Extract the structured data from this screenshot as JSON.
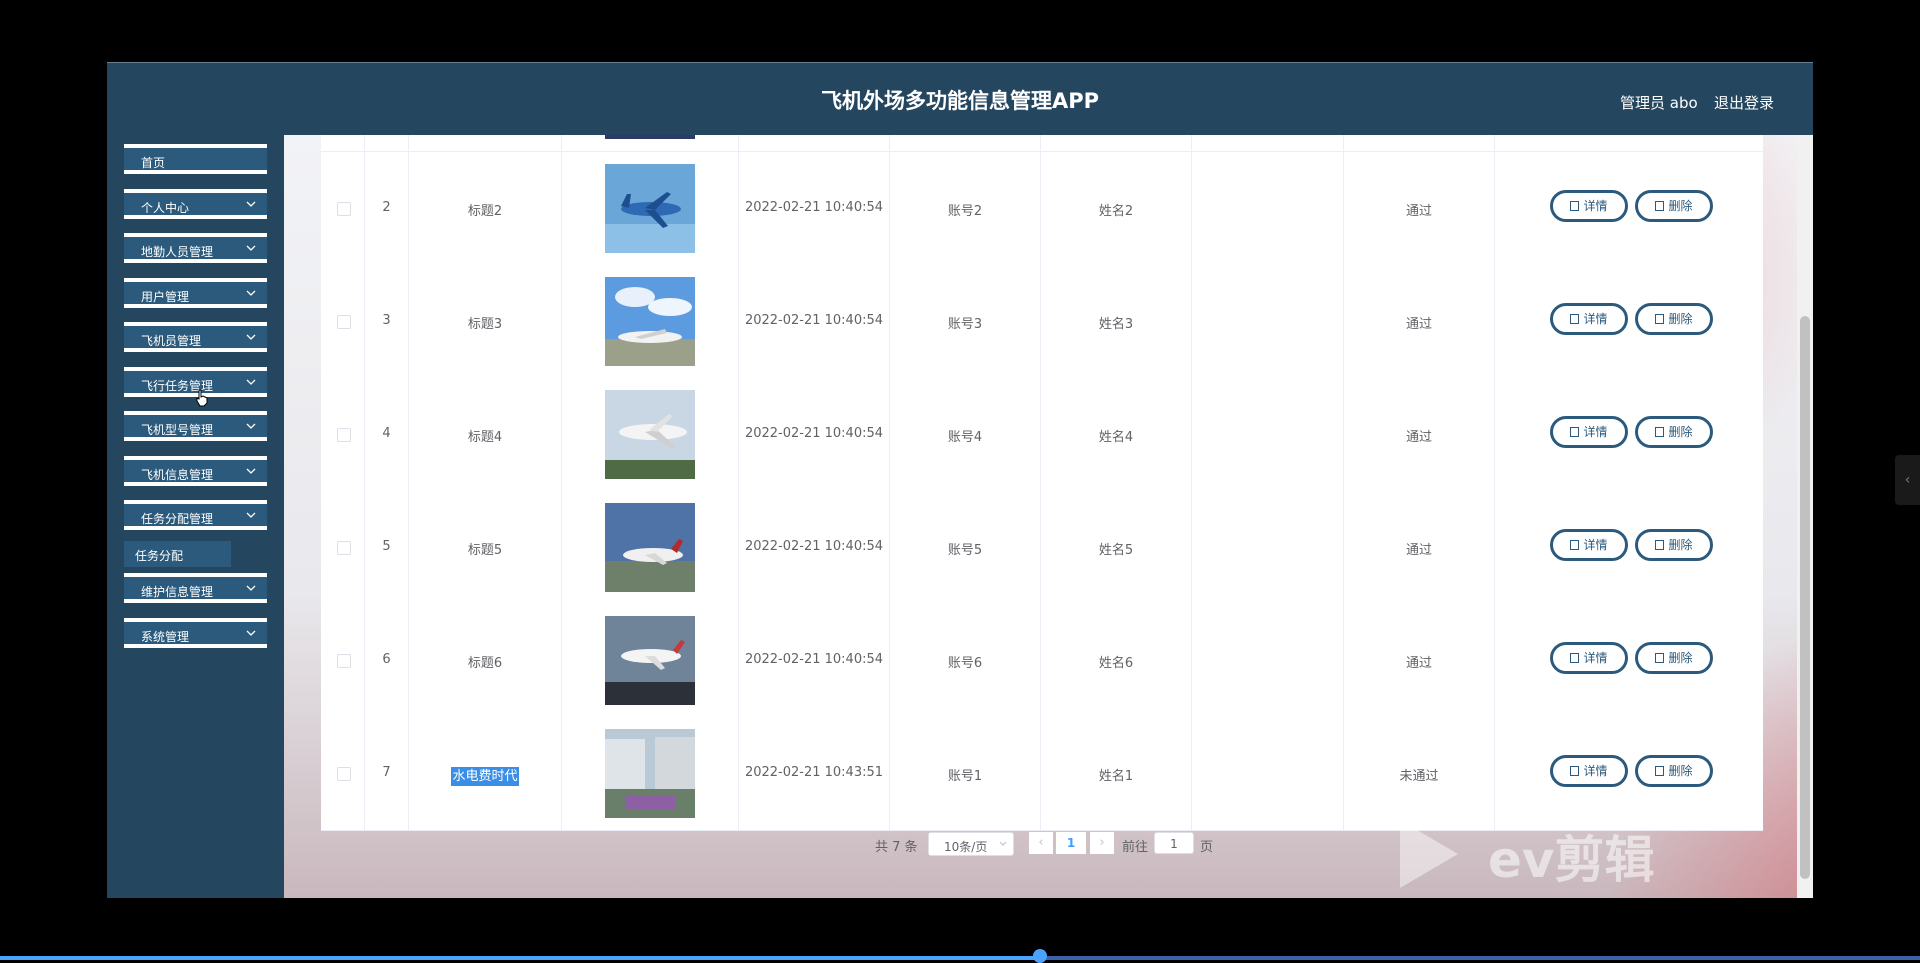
{
  "header": {
    "title": "飞机外场多功能信息管理APP",
    "user_label": "管理员 abo",
    "logout_label": "退出登录"
  },
  "sidebar": {
    "items": [
      {
        "label": "首页",
        "has_children": false
      },
      {
        "label": "个人中心",
        "has_children": true
      },
      {
        "label": "地勤人员管理",
        "has_children": true
      },
      {
        "label": "用户管理",
        "has_children": true
      },
      {
        "label": "飞机员管理",
        "has_children": true
      },
      {
        "label": "飞行任务管理",
        "has_children": true
      },
      {
        "label": "飞机型号管理",
        "has_children": true
      },
      {
        "label": "飞机信息管理",
        "has_children": true
      },
      {
        "label": "任务分配管理",
        "has_children": true
      },
      {
        "label": "维护信息管理",
        "has_children": true
      },
      {
        "label": "系统管理",
        "has_children": true
      }
    ],
    "submenu": {
      "label": "任务分配"
    }
  },
  "table": {
    "rows": [
      {
        "index": "2",
        "title": "标题2",
        "time": "2022-02-21 10:40:54",
        "account": "账号2",
        "name": "姓名2",
        "status": "通过"
      },
      {
        "index": "3",
        "title": "标题3",
        "time": "2022-02-21 10:40:54",
        "account": "账号3",
        "name": "姓名3",
        "status": "通过"
      },
      {
        "index": "4",
        "title": "标题4",
        "time": "2022-02-21 10:40:54",
        "account": "账号4",
        "name": "姓名4",
        "status": "通过"
      },
      {
        "index": "5",
        "title": "标题5",
        "time": "2022-02-21 10:40:54",
        "account": "账号5",
        "name": "姓名5",
        "status": "通过"
      },
      {
        "index": "6",
        "title": "标题6",
        "time": "2022-02-21 10:40:54",
        "account": "账号6",
        "name": "姓名6",
        "status": "通过"
      },
      {
        "index": "7",
        "title": "水电费时代",
        "time": "2022-02-21 10:43:51",
        "account": "账号1",
        "name": "姓名1",
        "status": "未通过"
      }
    ],
    "detail_label": "详情",
    "delete_label": "删除"
  },
  "pagination": {
    "total": "共 7 条",
    "page_size": "10条/页",
    "current_page": "1",
    "goto_label": "前往",
    "goto_value": "1",
    "page_suffix": "页"
  },
  "watermark": {
    "text": "ev剪辑"
  },
  "player": {
    "progress": 0.54
  }
}
